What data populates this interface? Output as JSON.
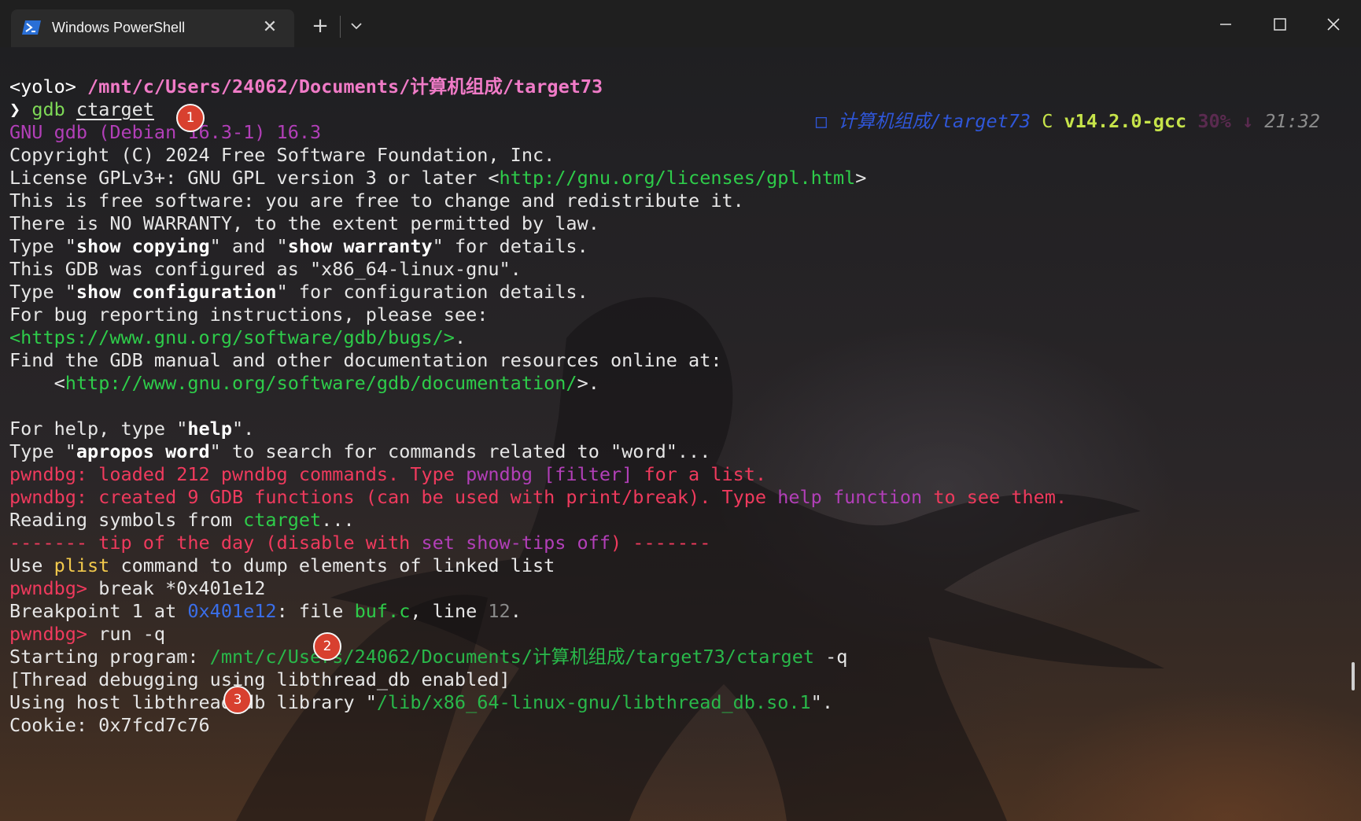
{
  "window": {
    "tab_title": "Windows PowerShell",
    "tab_close": "✕",
    "new_tab": "+"
  },
  "colors": {
    "prompt_path": "#f07bc7",
    "link_green": "#2ecc4a",
    "pwndbg_red": "#ef3a5d",
    "magenta": "#b23fb8",
    "marker_red": "#d8402f"
  },
  "prompt": {
    "user": "<yolo>",
    "path": "/mnt/c/Users/24062/Documents/计算机组成/target73",
    "arrow": "❯",
    "cmd_name": "gdb",
    "cmd_arg": "ctarget"
  },
  "right_prompt": {
    "icon": "□",
    "path": "计算机组成/target73",
    "lang_icon": "C",
    "version": "v14.2.0-gcc",
    "battery": "30%",
    "battery_icon": "↓",
    "time": "21:32"
  },
  "terminal": {
    "gdb_version": "GNU gdb (Debian 16.3-1) 16.3",
    "copyright": "Copyright (C) 2024 Free Software Foundation, Inc.",
    "license_pre": "License GPLv3+: GNU GPL version 3 or later <",
    "license_url": "http://gnu.org/licenses/gpl.html",
    "license_post": ">",
    "free_sw": "This is free software: you are free to change and redistribute it.",
    "warranty": "There is NO WARRANTY, to the extent permitted by law.",
    "type_pre": "Type \"",
    "show_copying": "show copying",
    "and_txt": "\" and \"",
    "show_warranty": "show warranty",
    "for_details": "\" for details.",
    "configured": "This GDB was configured as \"x86_64-linux-gnu\".",
    "type_config_pre": "Type \"",
    "show_config": "show configuration",
    "config_post": "\" for configuration details.",
    "bug_reporting": "For bug reporting instructions, please see:",
    "bugs_url": "<https://www.gnu.org/software/gdb/bugs/>",
    "bugs_post": ".",
    "find_manual": "Find the GDB manual and other documentation resources online at:",
    "doc_pre": "    <",
    "doc_url": "http://www.gnu.org/software/gdb/documentation/",
    "doc_post": ">.",
    "help_pre": "For help, type \"",
    "help_word": "help",
    "help_post": "\".",
    "apropos_pre": "Type \"",
    "apropos_word": "apropos word",
    "apropos_post": "\" to search for commands related to \"word\"...",
    "loaded_pre": "pwndbg: loaded 212 pwndbg commands. Type ",
    "loaded_mid": "pwndbg [filter]",
    "loaded_post": " for a list.",
    "created_pre": "pwndbg: created 9 GDB functions (can be used with print/break). Type ",
    "created_mid": "help function",
    "created_post": " to see them.",
    "reading_pre": "Reading symbols from ",
    "reading_file": "ctarget",
    "reading_post": "...",
    "tip_pre": "------- tip of the day (disable with ",
    "tip_mid": "set show-tips off",
    "tip_post": ") -------",
    "use_pre": "Use ",
    "use_cmd": "plist",
    "use_post": " command to dump elements of linked list",
    "prompt_pwndbg": "pwndbg>",
    "break_cmd": " break *0x401e12",
    "bp_pre": "Breakpoint 1 at ",
    "bp_addr": "0x401e12",
    "bp_mid": ": file ",
    "bp_file": "buf.c",
    "bp_line_txt": ", line ",
    "bp_line": "12",
    "bp_post": ".",
    "run_cmd": " run -q",
    "start_pre": "Starting program: ",
    "start_path": "/mnt/c/Users/24062/Documents/计算机组成/target73/ctarget",
    "start_post": " -q",
    "thread": "[Thread debugging using libthread_db enabled]",
    "host_pre": "Using host libthread_db library \"",
    "host_path": "/lib/x86_64-linux-gnu/libthread_db.so.1",
    "host_post": "\".",
    "cookie": "Cookie: 0x7fcd7c76"
  },
  "markers": [
    "1",
    "2",
    "3"
  ]
}
